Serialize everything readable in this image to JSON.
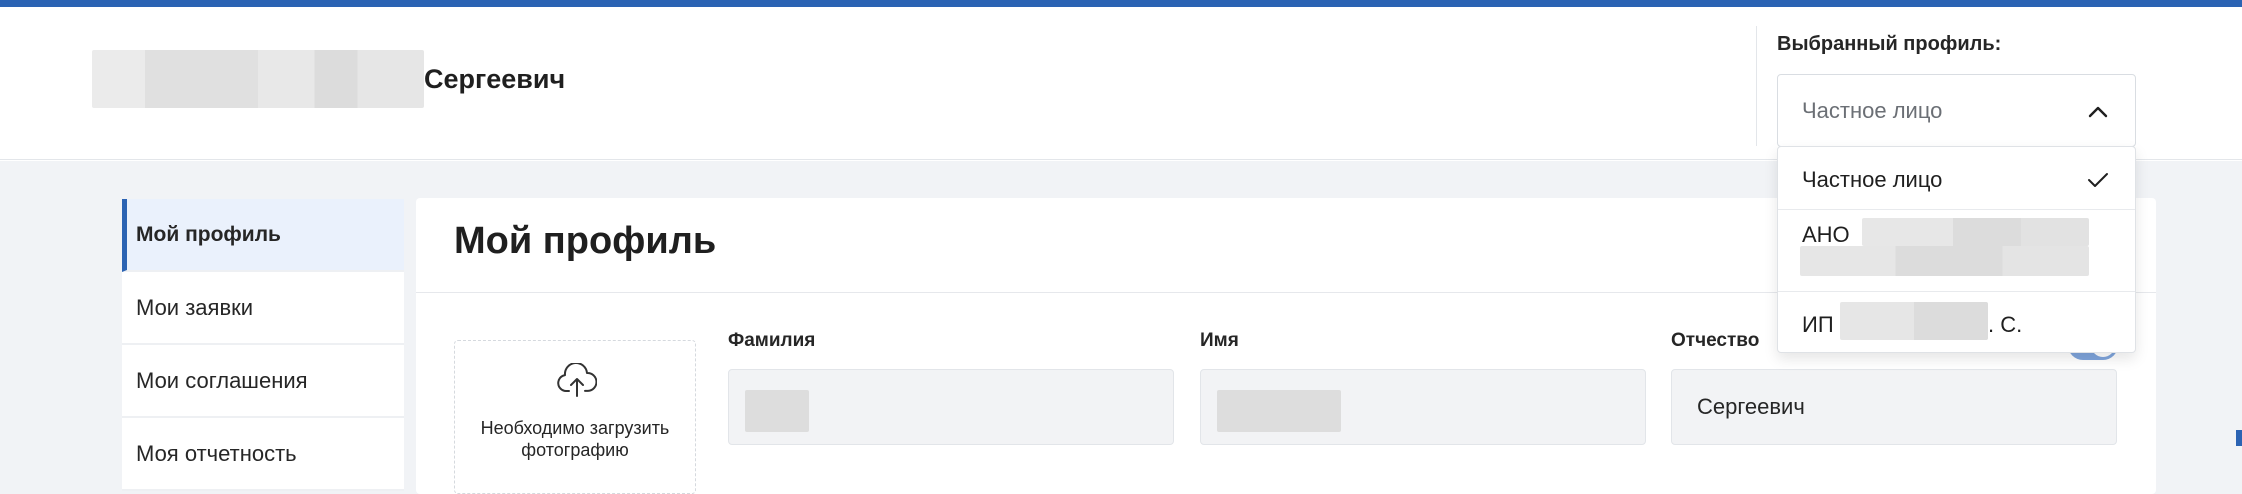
{
  "header": {
    "user_name_visible": "Сергеевич",
    "profile_label": "Выбранный профиль:",
    "profile_selected": "Частное лицо"
  },
  "profile_options": [
    {
      "label": "Частное лицо",
      "selected": true
    },
    {
      "label": "АНО",
      "selected": false
    },
    {
      "label_prefix": "ИП",
      "label_suffix": ". С.",
      "selected": false
    }
  ],
  "sidebar": {
    "items": [
      {
        "label": "Мой профиль",
        "active": true
      },
      {
        "label": "Мои заявки",
        "active": false
      },
      {
        "label": "Мои соглашения",
        "active": false
      },
      {
        "label": "Моя отчетность",
        "active": false
      }
    ]
  },
  "main": {
    "title": "Мой профиль",
    "photo_caption": "Необходимо загрузить фотографию",
    "fields": {
      "last_name_label": "Фамилия",
      "first_name_label": "Имя",
      "patronymic_label": "Отчество",
      "patronymic_value": "Сергеевич"
    }
  },
  "icons": {
    "chevron": "chevron-up-icon",
    "check": "check-icon",
    "upload": "cloud-upload-icon"
  },
  "colors": {
    "accent": "#2b63b3",
    "background": "#f1f3f6",
    "active_item_bg": "#eaf1fc"
  }
}
